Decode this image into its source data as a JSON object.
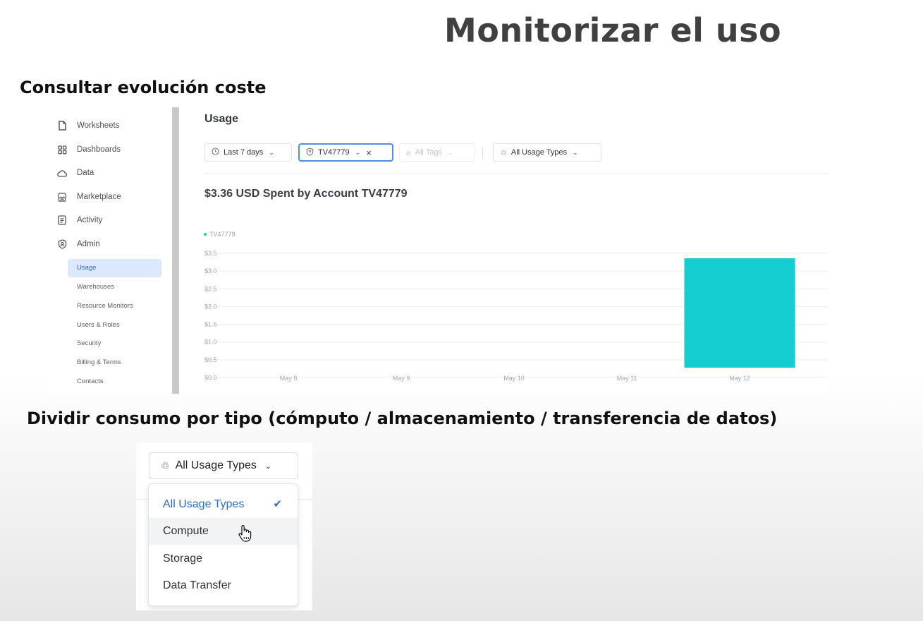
{
  "slide": {
    "title": "Monitorizar el uso",
    "section1": "Consultar evolución coste",
    "section2": "Dividir consumo por tipo (cómputo / almacenamiento / transferencia de datos)"
  },
  "sidebar": {
    "items": [
      {
        "label": "Worksheets",
        "icon": "file-icon"
      },
      {
        "label": "Dashboards",
        "icon": "grid-icon"
      },
      {
        "label": "Data",
        "icon": "cloud-icon"
      },
      {
        "label": "Marketplace",
        "icon": "store-icon"
      },
      {
        "label": "Activity",
        "icon": "activity-icon"
      },
      {
        "label": "Admin",
        "icon": "shield-icon"
      }
    ],
    "subitems": [
      "Usage",
      "Warehouses",
      "Resource Monitors",
      "Users & Roles",
      "Security",
      "Billing & Terms",
      "Contacts"
    ],
    "active_subitem": "Usage"
  },
  "usage": {
    "title": "Usage",
    "filters": {
      "range": "Last 7 days",
      "account": "TV47779",
      "tags": "All Tags",
      "types": "All Usage Types"
    },
    "spent_heading": "$3.36 USD Spent by Account TV47779"
  },
  "chart_data": {
    "type": "bar",
    "title": "",
    "xlabel": "",
    "ylabel": "",
    "categories": [
      "May 8",
      "May 9",
      "May 10",
      "May 11",
      "May 12"
    ],
    "series": [
      {
        "name": "TV47779",
        "values": [
          0,
          0,
          0,
          0,
          3.36
        ],
        "color": "#13cdd1"
      }
    ],
    "yticks": [
      "$0.0",
      "$0.5",
      "$1.0",
      "$1.5",
      "$2.0",
      "$2.5",
      "$3.0",
      "$3.5"
    ],
    "ylim": [
      0,
      3.5
    ],
    "grid": true,
    "legend": "top-left"
  },
  "dropdown": {
    "button_label": "All Usage Types",
    "options": [
      "All Usage Types",
      "Compute",
      "Storage",
      "Data Transfer"
    ],
    "selected": "All Usage Types",
    "hovered": "Compute",
    "accent": "#2c6ccf"
  }
}
